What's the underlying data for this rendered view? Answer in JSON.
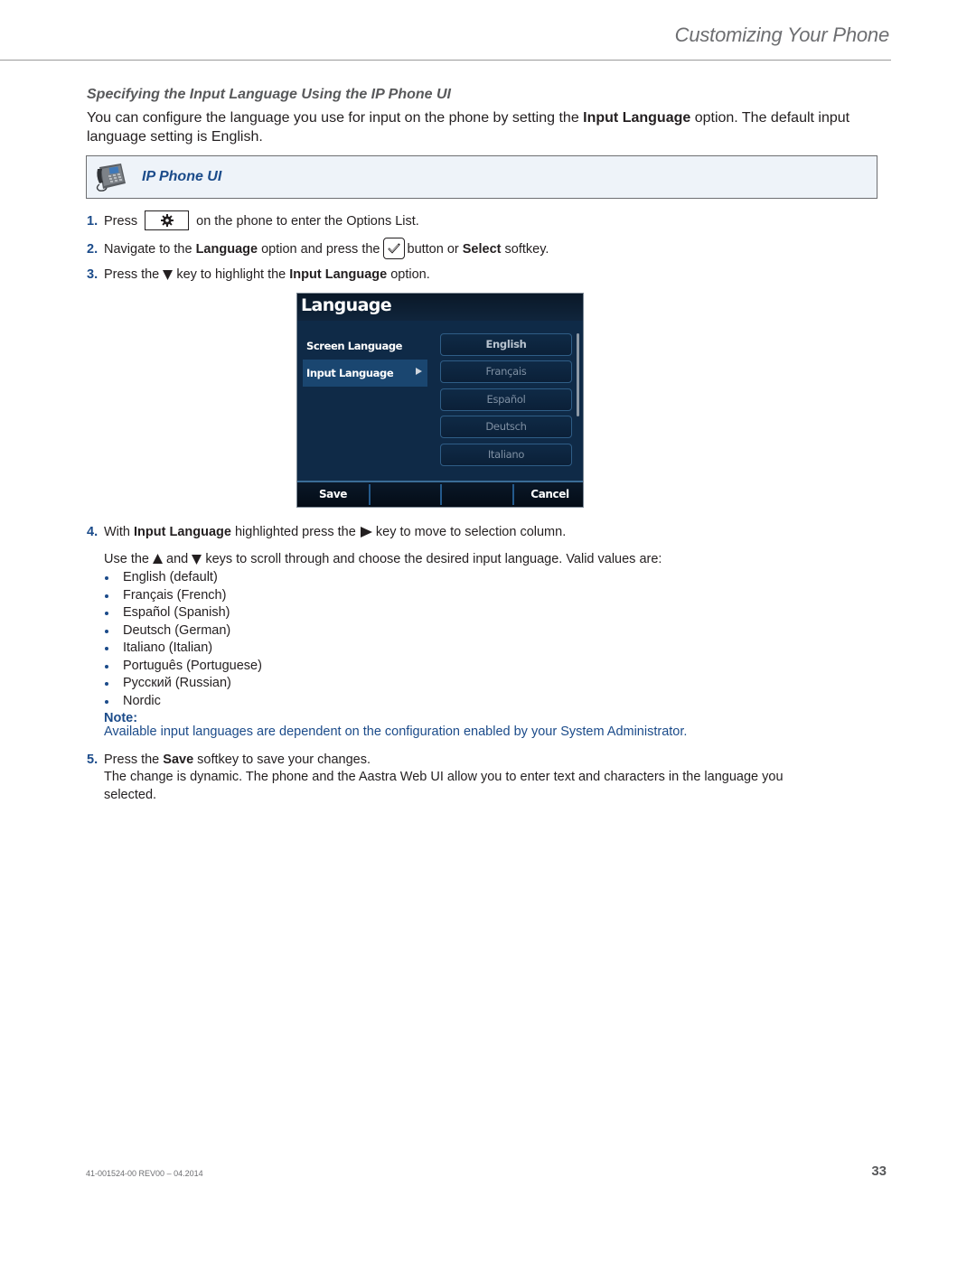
{
  "header": {
    "running_title": "Customizing Your Phone"
  },
  "section": {
    "title": "Specifying the Input Language Using the IP Phone UI",
    "intro_prefix": "You can configure the language you use for input on the phone by setting the ",
    "intro_bold": "Input Language",
    "intro_suffix": " option. The default input language setting is English."
  },
  "banner": {
    "icon": "desk-phone-icon",
    "title": "IP Phone UI"
  },
  "steps": [
    {
      "num": "1.",
      "parts": [
        "Press",
        "on the phone to enter the Options List."
      ],
      "icon": "options-gear-key-icon"
    },
    {
      "num": "2.",
      "parts": [
        "Navigate to the ",
        "Language",
        " option and press the",
        "button or ",
        "Select",
        " softkey."
      ],
      "icon": "select-check-key-icon"
    },
    {
      "num": "3.",
      "parts": [
        "Press the",
        "key to highlight the ",
        "Input Language",
        " option."
      ],
      "icon": "down-arrow-key-icon"
    },
    {
      "num": "4.",
      "parts": [
        "With ",
        "Input Language",
        " highlighted press the",
        "key to move to selection column."
      ],
      "icon": "right-arrow-key-icon"
    },
    {
      "num": "5.",
      "parts": [
        "Press the ",
        "Save",
        " softkey to save your changes."
      ]
    }
  ],
  "phone_screen": {
    "title": "Language",
    "menu_items": [
      {
        "label": "Screen Language",
        "selected": false
      },
      {
        "label": "Input Language",
        "selected": true
      }
    ],
    "options": [
      "English",
      "Français",
      "Español",
      "Deutsch",
      "Italiano"
    ],
    "current_option": "English",
    "softkeys": {
      "left": "Save",
      "right": "Cancel"
    }
  },
  "scroll_instruction": {
    "prefix": "Use the",
    "middle": "and",
    "suffix": "keys to scroll through and choose the desired input language. Valid values are:"
  },
  "valid_values": [
    "English (default)",
    "Français (French)",
    "Español (Spanish)",
    "Deutsch (German)",
    "Italiano (Italian)",
    "Português (Portuguese)",
    "Русский (Russian)",
    "Nordic"
  ],
  "note": {
    "label": "Note:",
    "text": "Available input languages are dependent on the configuration enabled by your System Administrator."
  },
  "step5_detail": "The change is dynamic. The phone and the Aastra Web UI allow you to enter text and characters in the language you selected.",
  "footer": {
    "doc_id": "41-001524-00 REV00 – 04.2014",
    "page_number": "33"
  },
  "colors": {
    "accent_blue": "#1b4b8a",
    "banner_bg": "#eef3f9",
    "screen_bg": "#0f2a47"
  }
}
